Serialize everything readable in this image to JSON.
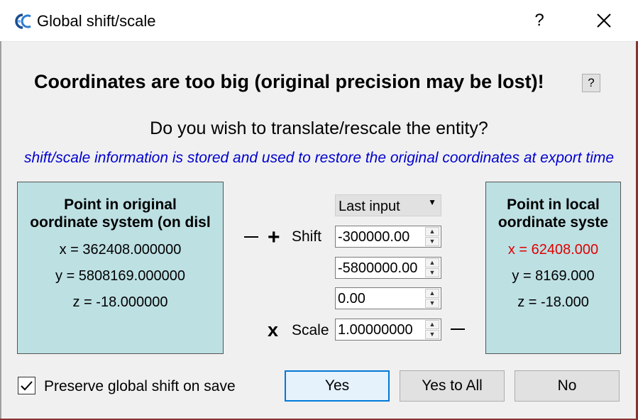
{
  "window": {
    "title": "Global shift/scale",
    "help_label": "?",
    "close_icon": "close-icon",
    "logo_text": "CC"
  },
  "main": {
    "heading": "Coordinates are too big (original precision may be lost)!",
    "heading_help": "?",
    "question": "Do you wish to translate/rescale the entity?",
    "info": "shift/scale information is stored and used to restore the original coordinates at export time"
  },
  "original": {
    "title_line1": "Point in original",
    "title_line2": "oordinate system (on disl",
    "x": "x = 362408.000000",
    "y": "y = 5808169.000000",
    "z": "z = -18.000000"
  },
  "local": {
    "title_line1": "Point in local",
    "title_line2": "oordinate syste",
    "x": "x = 62408.000",
    "y": "y = 8169.000",
    "z": "z = -18.000",
    "x_color": "#e00000"
  },
  "controls": {
    "preset": "Last input",
    "minus_symbol": "—",
    "plus_symbol": "+",
    "shift_label": "Shift",
    "shift_x": "-300000.00",
    "shift_y": "-5800000.00",
    "shift_z": "0.00",
    "times_symbol": "x",
    "scale_label": "Scale",
    "scale": "1.00000000"
  },
  "footer": {
    "preserve_label": "Preserve global shift on save",
    "preserve_checked": true,
    "yes": "Yes",
    "yes_to_all": "Yes to All",
    "no": "No"
  },
  "colors": {
    "panel_bg": "#bde0e3",
    "info_text": "#0000d0",
    "accent": "#0078d7"
  }
}
